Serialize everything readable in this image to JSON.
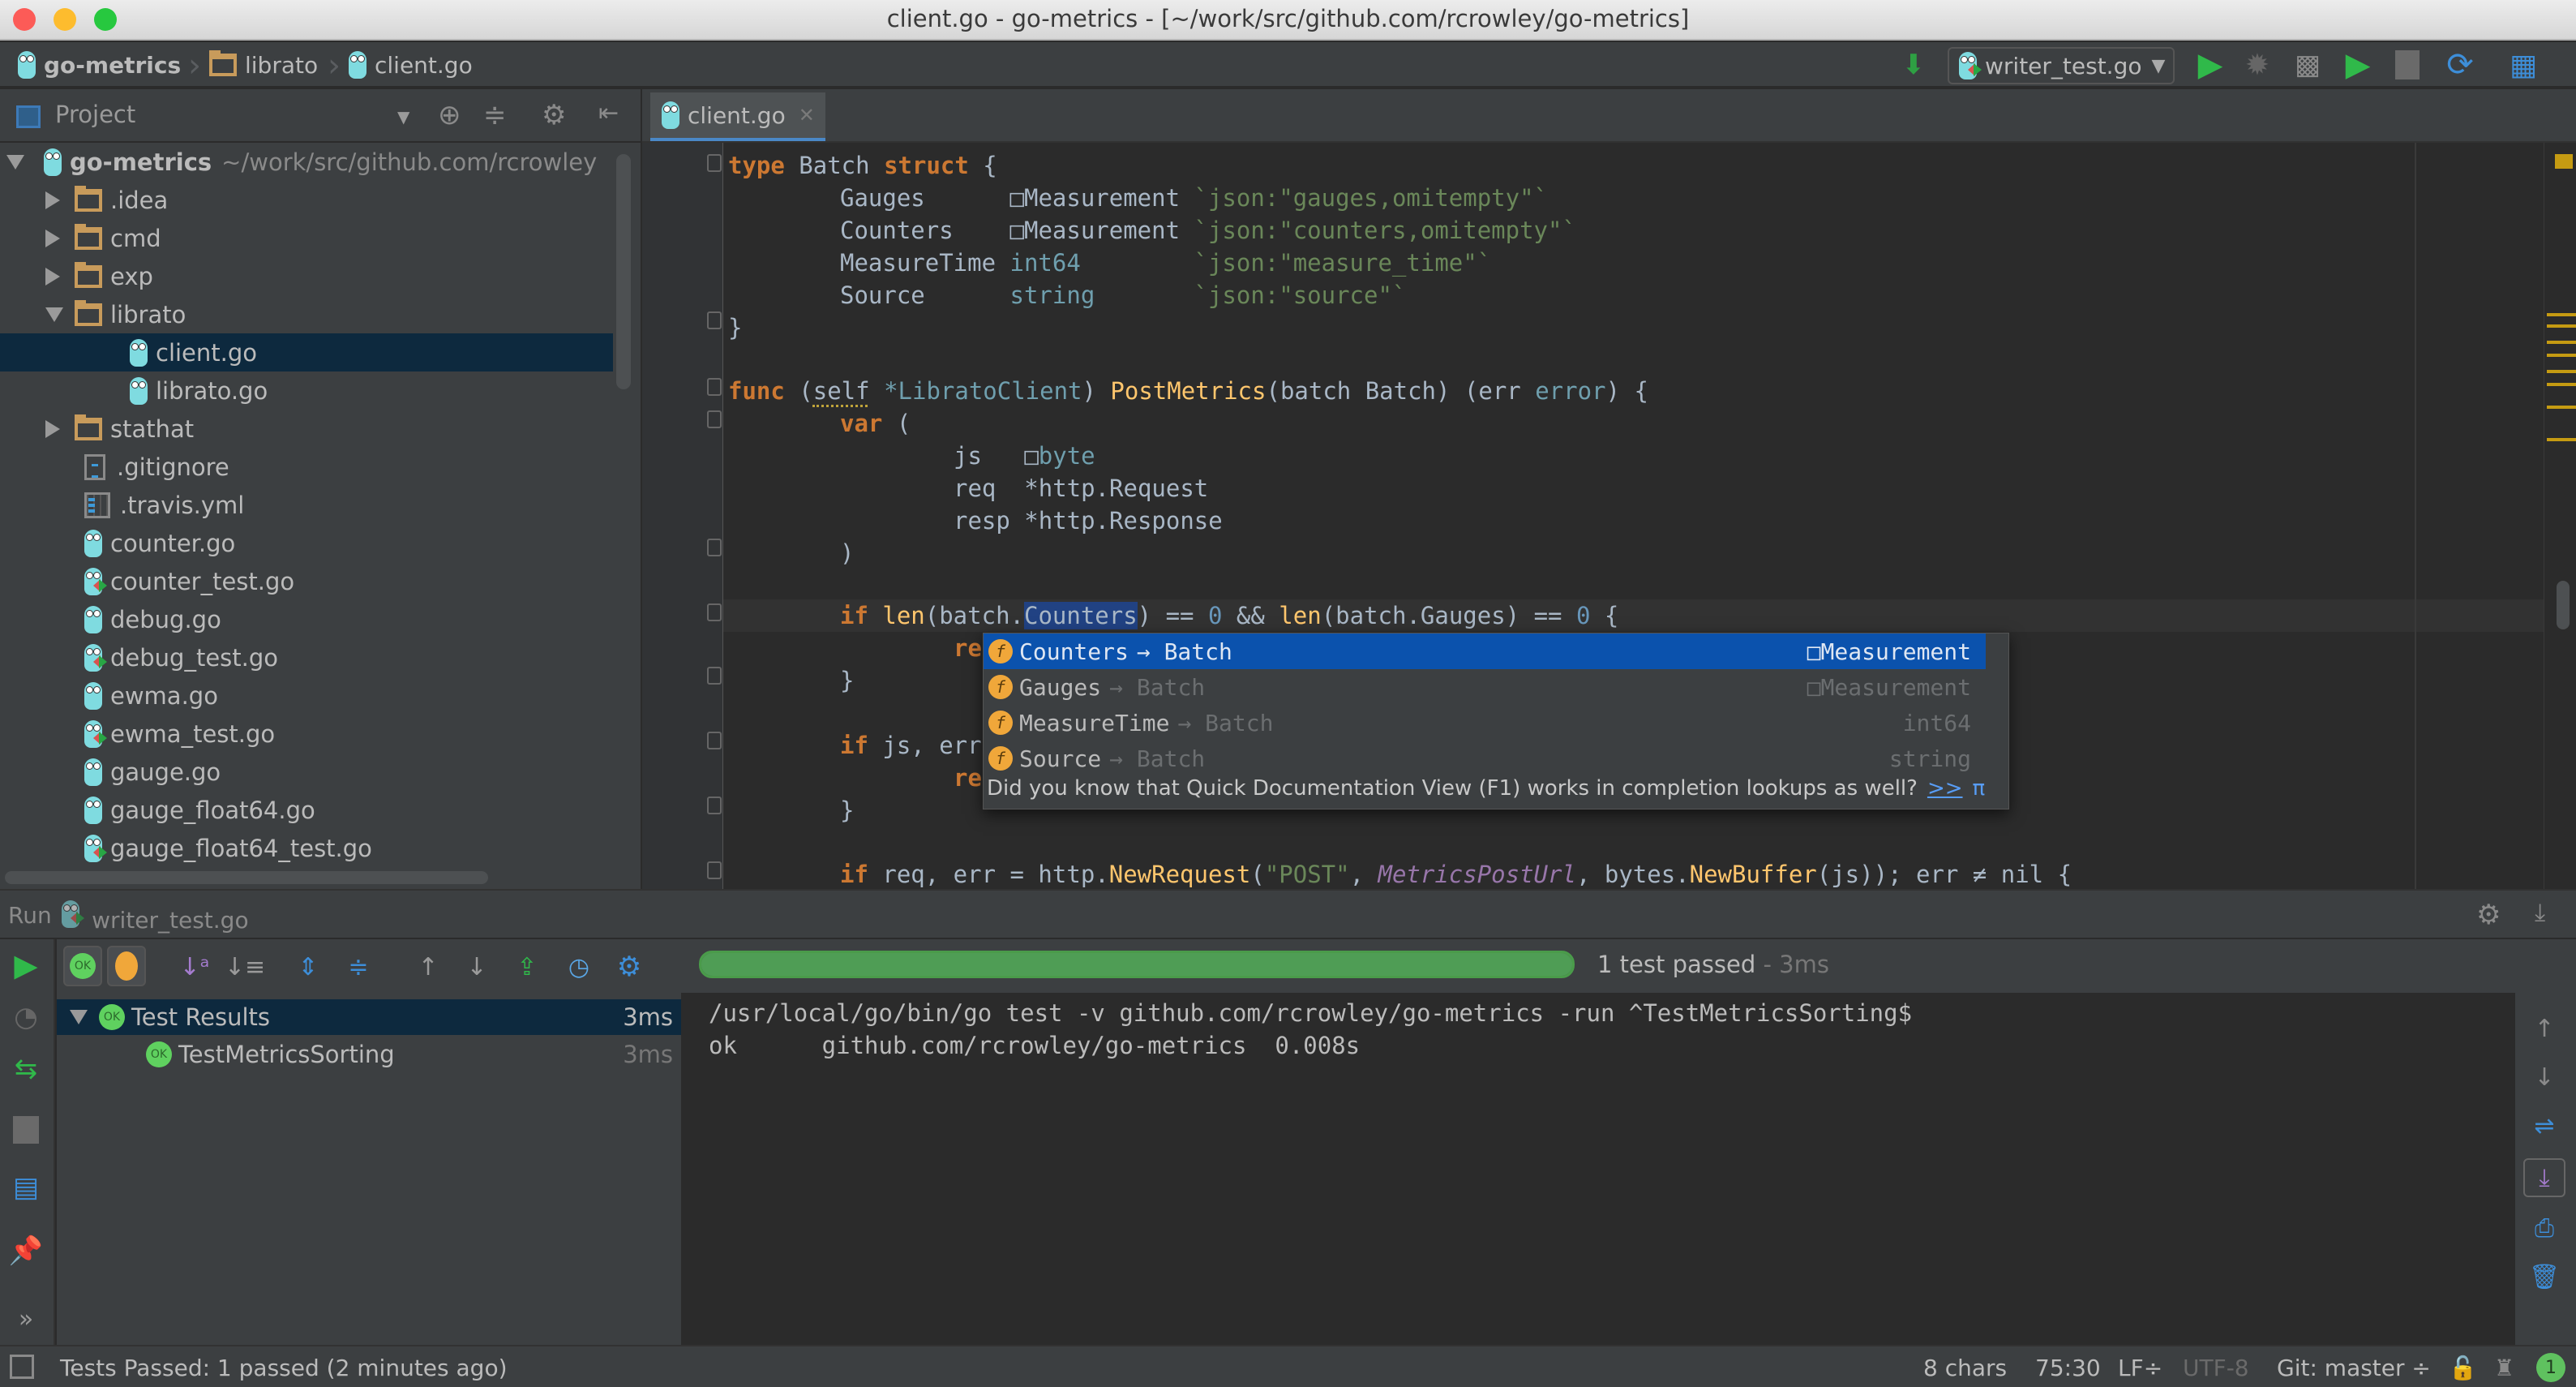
{
  "window": {
    "title": "client.go - go-metrics - [~/work/src/github.com/rcrowley/go-metrics]"
  },
  "navbar": {
    "breadcrumb": [
      "go-metrics",
      "librato",
      "client.go"
    ],
    "run_config": "writer_test.go"
  },
  "toolbar_icons": [
    "binary-download-icon",
    "run-config-dropdown",
    "run-icon",
    "debug-icon",
    "coverage-icon",
    "run-with-profiler-icon",
    "stop-icon",
    "sync-icon",
    "project-structure-icon"
  ],
  "project": {
    "header_label": "Project",
    "root": {
      "name": "go-metrics",
      "path": "~/work/src/github.com/rcrowley"
    },
    "items": [
      {
        "label": ".idea",
        "type": "folder",
        "expanded": false,
        "depth": 1
      },
      {
        "label": "cmd",
        "type": "folder",
        "expanded": false,
        "depth": 1
      },
      {
        "label": "exp",
        "type": "folder",
        "expanded": false,
        "depth": 1
      },
      {
        "label": "librato",
        "type": "folder",
        "expanded": true,
        "depth": 1
      },
      {
        "label": "client.go",
        "type": "go",
        "depth": 2,
        "selected": true
      },
      {
        "label": "librato.go",
        "type": "go",
        "depth": 2
      },
      {
        "label": "stathat",
        "type": "folder",
        "expanded": false,
        "depth": 1
      },
      {
        "label": ".gitignore",
        "type": "text",
        "depth": 1
      },
      {
        "label": ".travis.yml",
        "type": "yaml",
        "depth": 1
      },
      {
        "label": "counter.go",
        "type": "go",
        "depth": 1
      },
      {
        "label": "counter_test.go",
        "type": "go-test",
        "depth": 1
      },
      {
        "label": "debug.go",
        "type": "go",
        "depth": 1
      },
      {
        "label": "debug_test.go",
        "type": "go-test",
        "depth": 1
      },
      {
        "label": "ewma.go",
        "type": "go",
        "depth": 1
      },
      {
        "label": "ewma_test.go",
        "type": "go-test",
        "depth": 1
      },
      {
        "label": "gauge.go",
        "type": "go",
        "depth": 1
      },
      {
        "label": "gauge_float64.go",
        "type": "go",
        "depth": 1
      },
      {
        "label": "gauge_float64_test.go",
        "type": "go-test",
        "depth": 1
      }
    ]
  },
  "editor": {
    "tab": "client.go",
    "code": {
      "l1": {
        "kw1": "type",
        "name": " Batch ",
        "kw2": "struct",
        "rest": " {"
      },
      "l2": {
        "field": "Gauges      ",
        "box": "□",
        "type": "Measurement",
        "tag": " `json:\"gauges,omitempty\"`"
      },
      "l3": {
        "field": "Counters    ",
        "box": "□",
        "type": "Measurement",
        "tag": " `json:\"counters,omitempty\"`"
      },
      "l4": {
        "field": "MeasureTime ",
        "type": "int64",
        "tag": "        `json:\"measure_time\"`"
      },
      "l5": {
        "field": "Source      ",
        "type": "string",
        "tag": "       `json:\"source\"`"
      },
      "l6": "}",
      "l8": {
        "kw": "func",
        "p1": " (self ",
        "recv": "*LibratoClient",
        "p2": ") ",
        "fn": "PostMetrics",
        "p3": "(batch Batch) (err ",
        "ret": "error",
        "p4": ") {"
      },
      "l9": {
        "kw": "var",
        "rest": " ("
      },
      "l10": {
        "name": "js   ",
        "box": "□",
        "type": "byte"
      },
      "l11": "req  *http.Request",
      "l12": "resp *http.Response",
      "l13": ")",
      "l15": {
        "kw": "if",
        "fn1": " len",
        "p1": "(batch.",
        "sel": "Counters",
        "p2": ") == ",
        "n1": "0",
        "p3": " && ",
        "fn2": "len",
        "p4": "(batch.Gauges) == ",
        "n2": "0",
        "p5": " {"
      },
      "l16": "re",
      "l17": "}",
      "l19": {
        "kw": "if",
        "rest": " js, err"
      },
      "l20": "re",
      "l21": "}",
      "l23": {
        "kw": "if",
        "p1": " req, err = http.",
        "fn": "NewRequest",
        "p2": "(",
        "str": "\"POST\"",
        "p3": ", ",
        "glob": "MetricsPostUrl",
        "p4": ", bytes.",
        "fn2": "NewBuffer",
        "p5": "(js)); err ≠ nil {"
      }
    },
    "completion": {
      "items": [
        {
          "name": "Counters",
          "class": "→ Batch",
          "type": "□Measurement",
          "active": true
        },
        {
          "name": "Gauges",
          "class": "→ Batch",
          "type": "□Measurement"
        },
        {
          "name": "MeasureTime",
          "class": "→ Batch",
          "type": "int64"
        },
        {
          "name": "Source",
          "class": "→ Batch",
          "type": "string"
        }
      ],
      "hint": "Did you know that Quick Documentation View (F1) works in completion lookups as well?",
      "hint_link": ">>",
      "pi": "π"
    }
  },
  "run": {
    "label": "Run",
    "config": "writer_test.go",
    "progress_percent": 100,
    "summary": "1 test passed",
    "summary_time": " - 3ms",
    "tests": [
      {
        "name": "Test Results",
        "time": "3ms",
        "status": "OK",
        "root": true
      },
      {
        "name": "TestMetricsSorting",
        "time": "3ms",
        "status": "OK"
      }
    ],
    "console": [
      "/usr/local/go/bin/go test -v github.com/rcrowley/go-metrics -run ^TestMetricsSorting$",
      "ok      github.com/rcrowley/go-metrics  0.008s"
    ]
  },
  "statusbar": {
    "message": "Tests Passed: 1 passed (2 minutes ago)",
    "chars": "8 chars",
    "position": "75:30",
    "line_sep": "LF÷",
    "encoding": "UTF-8",
    "vcs": "Git: master ÷",
    "notifications": "1"
  },
  "colors": {
    "keyword": "#cc7832",
    "string": "#6a8759",
    "function": "#ffc66d",
    "selection": "#0b52ad",
    "tree_selection": "#0d293e",
    "pass_green": "#4f9d55"
  }
}
